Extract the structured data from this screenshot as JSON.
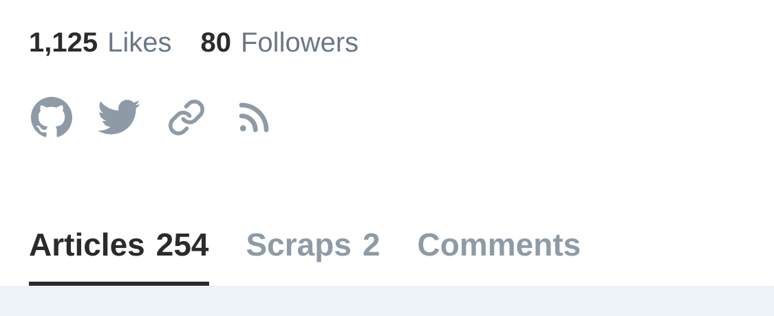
{
  "profile": {
    "stats": [
      {
        "value": "1,125",
        "label": "Likes"
      },
      {
        "value": "80",
        "label": "Followers"
      }
    ],
    "social_links": [
      {
        "icon": "github-icon"
      },
      {
        "icon": "twitter-icon"
      },
      {
        "icon": "link-icon"
      },
      {
        "icon": "rss-icon"
      }
    ],
    "icon_color": "#8e9ba7"
  },
  "tabs": [
    {
      "label": "Articles",
      "count": "254",
      "active": true
    },
    {
      "label": "Scraps",
      "count": "2",
      "active": false
    },
    {
      "label": "Comments",
      "count": "",
      "active": false
    }
  ],
  "colors": {
    "text_primary": "#2b2b2b",
    "text_muted": "#6b7785",
    "tab_inactive": "#8e9ba7",
    "content_bg": "#eef2f9"
  }
}
